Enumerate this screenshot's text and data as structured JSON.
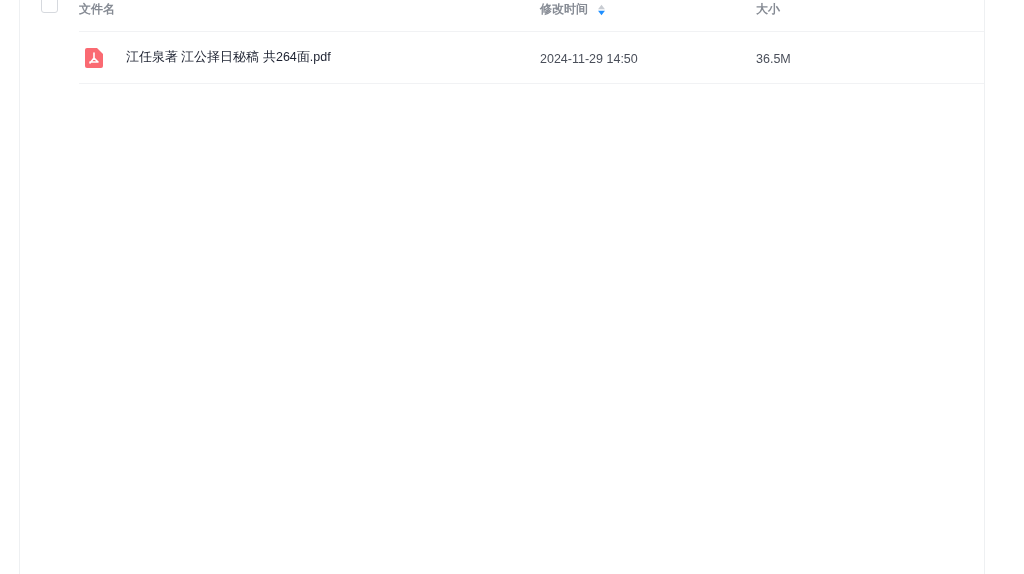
{
  "table": {
    "select_all": {
      "checked": false
    },
    "columns": [
      {
        "label": "文件名",
        "sorted": false
      },
      {
        "label": "修改时间",
        "sorted": true,
        "descending": true
      },
      {
        "label": "大小",
        "sorted": false
      }
    ],
    "rows": [
      {
        "kind": "pdf",
        "name": "江任泉著 江公择日秘稿 共264面.pdf",
        "modified": "2024-11-29 14:50",
        "size": "36.5M"
      }
    ]
  }
}
